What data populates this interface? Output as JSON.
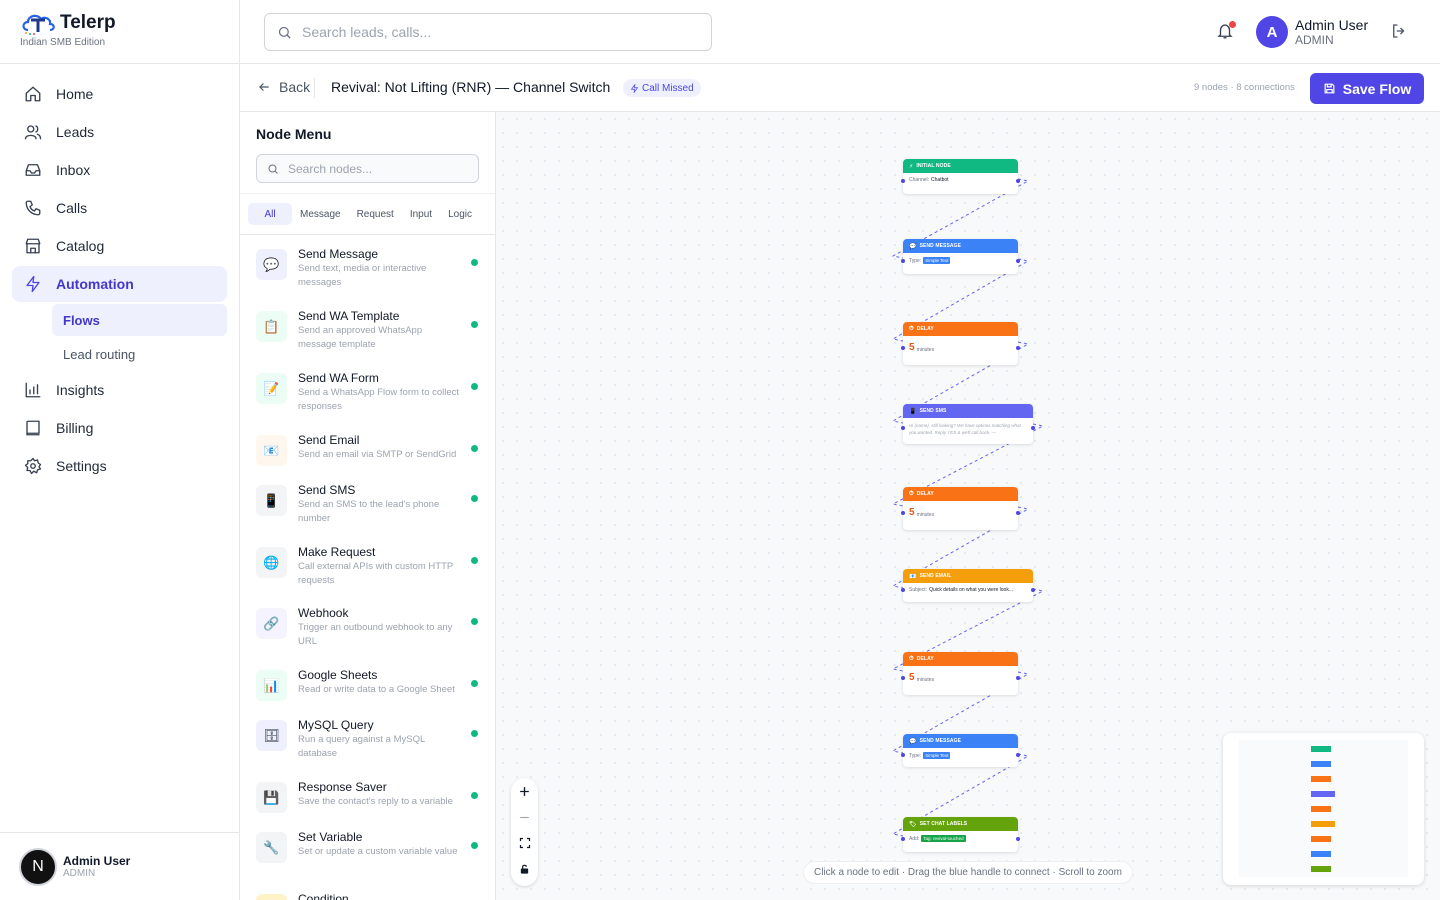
{
  "brand": {
    "name": "Telerp",
    "subtitle": "Indian SMB Edition"
  },
  "nav": {
    "items": [
      {
        "label": "Home",
        "icon": "home-icon"
      },
      {
        "label": "Leads",
        "icon": "users-icon"
      },
      {
        "label": "Inbox",
        "icon": "inbox-icon"
      },
      {
        "label": "Calls",
        "icon": "phone-icon"
      },
      {
        "label": "Catalog",
        "icon": "store-icon"
      },
      {
        "label": "Automation",
        "icon": "bolt-icon",
        "active": true
      }
    ],
    "sub_items": [
      {
        "label": "Flows",
        "active": true
      },
      {
        "label": "Lead routing"
      }
    ],
    "items_after": [
      {
        "label": "Insights",
        "icon": "bar-chart-icon"
      },
      {
        "label": "Billing",
        "icon": "book-icon"
      },
      {
        "label": "Settings",
        "icon": "gear-icon"
      }
    ]
  },
  "sidebar_user": {
    "initial": "N",
    "name": "Admin User",
    "role": "ADMIN"
  },
  "topbar": {
    "search_placeholder": "Search leads, calls...",
    "user_initial": "A",
    "user_name": "Admin User",
    "user_role": "ADMIN"
  },
  "flow_header": {
    "back_label": "Back",
    "title": "Revival: Not Lifting (RNR) — Channel Switch",
    "trigger_badge": "Call Missed",
    "stats": "9 nodes · 8 connections",
    "save_label": "Save Flow"
  },
  "node_menu": {
    "title": "Node Menu",
    "search_placeholder": "Search nodes...",
    "tabs": [
      "All",
      "Message",
      "Request",
      "Input",
      "Logic"
    ],
    "items": [
      {
        "name": "Send Message",
        "desc": "Send text, media or interactive messages",
        "icon": "💬",
        "bg": "#eef0fd"
      },
      {
        "name": "Send WA Template",
        "desc": "Send an approved WhatsApp message template",
        "icon": "📋",
        "bg": "#ecfdf5"
      },
      {
        "name": "Send WA Form",
        "desc": "Send a WhatsApp Flow form to collect responses",
        "icon": "📝",
        "bg": "#ecfdf5"
      },
      {
        "name": "Send Email",
        "desc": "Send an email via SMTP or SendGrid",
        "icon": "📧",
        "bg": "#fff7ed"
      },
      {
        "name": "Send SMS",
        "desc": "Send an SMS to the lead's phone number",
        "icon": "📱",
        "bg": "#f3f4f6"
      },
      {
        "name": "Make Request",
        "desc": "Call external APIs with custom HTTP requests",
        "icon": "🌐",
        "bg": "#f3f4f6"
      },
      {
        "name": "Webhook",
        "desc": "Trigger an outbound webhook to any URL",
        "icon": "🔗",
        "bg": "#f5f3ff"
      },
      {
        "name": "Google Sheets",
        "desc": "Read or write data to a Google Sheet",
        "icon": "📊",
        "bg": "#ecfdf5"
      },
      {
        "name": "MySQL Query",
        "desc": "Run a query against a MySQL database",
        "icon": "🗄",
        "bg": "#eef0fd"
      },
      {
        "name": "Response Saver",
        "desc": "Save the contact's reply to a variable",
        "icon": "💾",
        "bg": "#f3f4f6"
      },
      {
        "name": "Set Variable",
        "desc": "Set or update a custom variable value",
        "icon": "🔧",
        "bg": "#f3f4f6"
      },
      {
        "name": "Condition",
        "desc": "",
        "icon": "🔀",
        "bg": "#fef3c7"
      }
    ]
  },
  "flow_nodes": [
    {
      "title": "INITIAL NODE",
      "color": "#10b981",
      "icon": "⚡",
      "label": "Channel:",
      "value": "Chatbot",
      "kind": "text"
    },
    {
      "title": "SEND MESSAGE",
      "color": "#3b82f6",
      "icon": "💬",
      "label": "Type:",
      "value": "Simple Text",
      "kind": "tag"
    },
    {
      "title": "DELAY",
      "color": "#f97316",
      "icon": "⏱",
      "value": "5",
      "unit": "minutes",
      "kind": "delay"
    },
    {
      "title": "SEND SMS",
      "color": "#6366f1",
      "icon": "📱",
      "value": "Hi {name}, still looking? We have options matching what you wanted. Reply YES & we'll call back. —",
      "kind": "sms"
    },
    {
      "title": "DELAY",
      "color": "#f97316",
      "icon": "⏱",
      "value": "5",
      "unit": "minutes",
      "kind": "delay"
    },
    {
      "title": "SEND EMAIL",
      "color": "#f59e0b",
      "icon": "📧",
      "label": "Subject:",
      "value": "Quick details on what you were look...",
      "kind": "text"
    },
    {
      "title": "DELAY",
      "color": "#f97316",
      "icon": "⏱",
      "value": "5",
      "unit": "minutes",
      "kind": "delay"
    },
    {
      "title": "SEND MESSAGE",
      "color": "#3b82f6",
      "icon": "💬",
      "label": "Type:",
      "value": "Simple Text",
      "kind": "tag"
    },
    {
      "title": "SET CHAT LABELS",
      "color": "#65a30d",
      "icon": "🏷",
      "label": "Add:",
      "value": "Tag: revival-touched",
      "kind": "tag-green"
    }
  ],
  "canvas": {
    "hint": "Click a node to edit · Drag the blue handle to connect · Scroll to zoom",
    "minimap_colors": [
      "#10b981",
      "#3b82f6",
      "#f97316",
      "#6366f1",
      "#f97316",
      "#f59e0b",
      "#f97316",
      "#3b82f6",
      "#65a30d"
    ]
  }
}
